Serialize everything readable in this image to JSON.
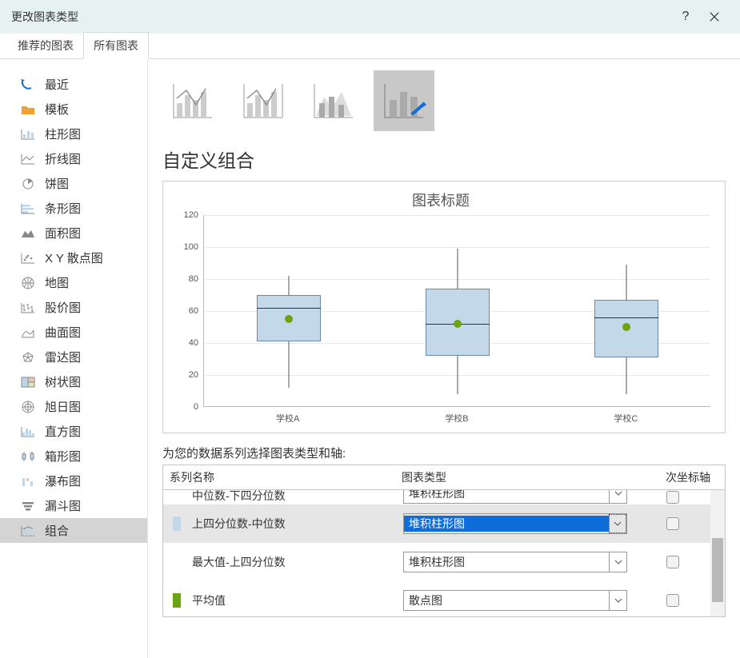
{
  "window": {
    "title": "更改图表类型",
    "help": "?",
    "close": "✕"
  },
  "tabs": {
    "recommended": "推荐的图表",
    "all": "所有图表"
  },
  "sidebar": [
    {
      "id": "recent",
      "label": "最近"
    },
    {
      "id": "templates",
      "label": "模板"
    },
    {
      "id": "column",
      "label": "柱形图"
    },
    {
      "id": "line",
      "label": "折线图"
    },
    {
      "id": "pie",
      "label": "饼图"
    },
    {
      "id": "bar",
      "label": "条形图"
    },
    {
      "id": "area",
      "label": "面积图"
    },
    {
      "id": "scatter",
      "label": "X Y 散点图"
    },
    {
      "id": "map",
      "label": "地图"
    },
    {
      "id": "stock",
      "label": "股价图"
    },
    {
      "id": "surface",
      "label": "曲面图"
    },
    {
      "id": "radar",
      "label": "雷达图"
    },
    {
      "id": "treemap",
      "label": "树状图"
    },
    {
      "id": "sunburst",
      "label": "旭日图"
    },
    {
      "id": "histogram",
      "label": "直方图"
    },
    {
      "id": "boxwhisker",
      "label": "箱形图"
    },
    {
      "id": "waterfall",
      "label": "瀑布图"
    },
    {
      "id": "funnel",
      "label": "漏斗图"
    },
    {
      "id": "combo",
      "label": "组合"
    }
  ],
  "section_title": "自定义组合",
  "preview_title": "图表标题",
  "instruction": "为您的数据系列选择图表类型和轴:",
  "series_header": {
    "name": "系列名称",
    "type": "图表类型",
    "axis": "次坐标轴"
  },
  "rows": {
    "partial_name": "中位数-下四分位数",
    "partial_type": "堆积柱形图",
    "r1_name": "上四分位数-中位数",
    "r1_type": "堆积柱形图",
    "r2_name": "最大值-上四分位数",
    "r2_type": "堆积柱形图",
    "r3_name": "平均值",
    "r3_type": "散点图"
  },
  "chart_data": {
    "type": "boxplot",
    "title": "图表标题",
    "ylim": [
      0,
      120
    ],
    "yticks": [
      0,
      20,
      40,
      60,
      80,
      100,
      120
    ],
    "categories": [
      "学校A",
      "学校B",
      "学校C"
    ],
    "series": [
      {
        "name": "学校A",
        "min": 12,
        "q1": 41,
        "median": 62,
        "q3": 70,
        "max": 82,
        "mean": 55
      },
      {
        "name": "学校B",
        "min": 8,
        "q1": 32,
        "median": 52,
        "q3": 74,
        "max": 99,
        "mean": 52
      },
      {
        "name": "学校C",
        "min": 8,
        "q1": 31,
        "median": 56,
        "q3": 67,
        "max": 89,
        "mean": 50
      }
    ]
  }
}
